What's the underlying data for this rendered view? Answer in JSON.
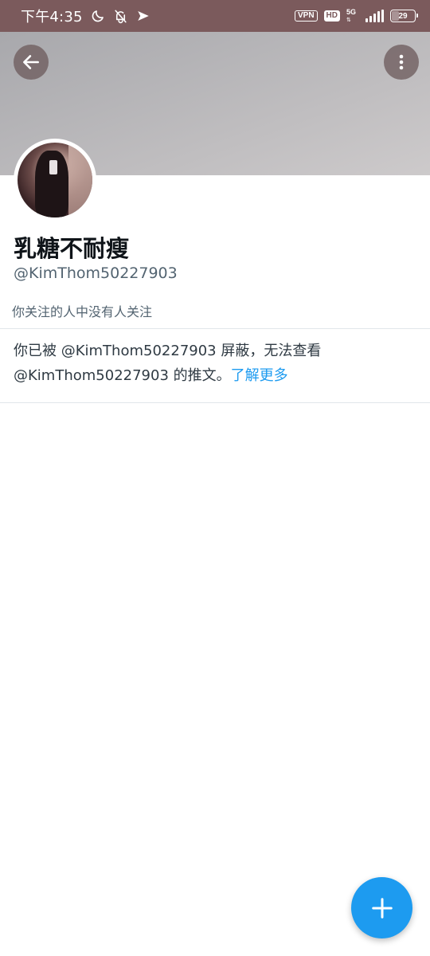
{
  "status_bar": {
    "time": "下午4:35",
    "vpn": "VPN",
    "hd": "HD",
    "network": "5G",
    "battery": "29",
    "battery_level": 0.29,
    "icons": [
      "moon-icon",
      "bell-off-icon",
      "location-arrow-icon",
      "signal-icon",
      "battery-icon"
    ]
  },
  "header": {
    "back_icon": "arrow-left-icon",
    "more_icon": "more-vertical-icon"
  },
  "profile": {
    "display_name": "乳糖不耐瘦",
    "handle": "@KimThom50227903",
    "followers_note": "你关注的人中没有人关注"
  },
  "blocked": {
    "message": "你已被 @KimThom50227903 屏蔽，无法查看 @KimThom50227903 的推文。",
    "link_text": "了解更多"
  },
  "fab": {
    "icon": "plus-icon"
  },
  "colors": {
    "status_bar": "#7b5a5c",
    "accent": "#1d9bf0",
    "secondary_text": "#536471"
  }
}
